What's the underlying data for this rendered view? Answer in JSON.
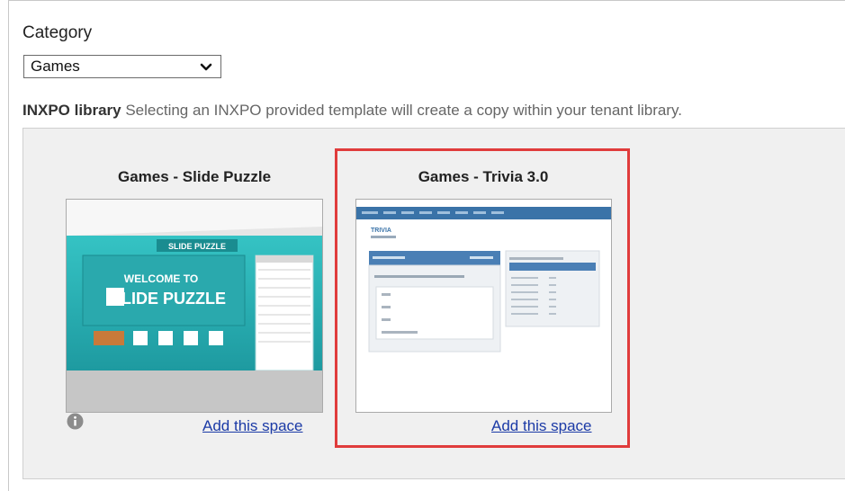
{
  "category": {
    "label": "Category",
    "selected": "Games"
  },
  "library": {
    "heading": "INXPO library",
    "description": " Selecting an INXPO provided template will create a copy within your tenant library."
  },
  "cards": [
    {
      "title": "Games - Slide Puzzle",
      "action": "Add this space",
      "thumb_text": [
        "WELCOME TO",
        "SLIDE PUZZLE"
      ]
    },
    {
      "title": "Games - Trivia 3.0",
      "action": "Add this space",
      "thumb_text": [
        "TRIVIA"
      ]
    }
  ],
  "colors": {
    "highlight": "#e03c3c",
    "link": "#1b3aa6",
    "puzzle_teal": "#2bb5b8",
    "trivia_blue": "#3a73a8"
  },
  "icons": [
    "chevron-down-icon",
    "info-icon"
  ]
}
